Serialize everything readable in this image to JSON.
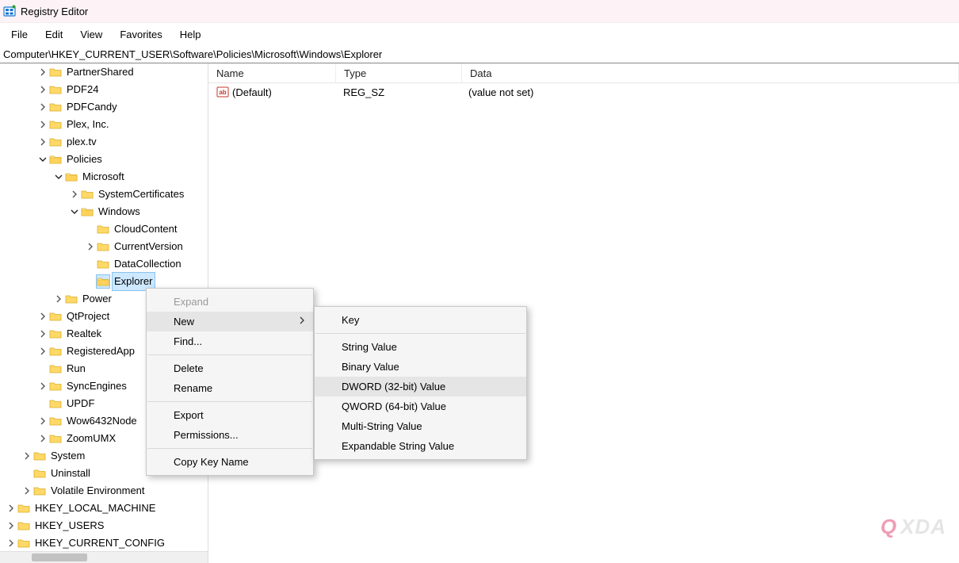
{
  "title": "Registry Editor",
  "menu": [
    "File",
    "Edit",
    "View",
    "Favorites",
    "Help"
  ],
  "address": "Computer\\HKEY_CURRENT_USER\\Software\\Policies\\Microsoft\\Windows\\Explorer",
  "tree": [
    {
      "depth": 2,
      "exp": "closed",
      "label": "PartnerShared"
    },
    {
      "depth": 2,
      "exp": "closed",
      "label": "PDF24"
    },
    {
      "depth": 2,
      "exp": "closed",
      "label": "PDFCandy"
    },
    {
      "depth": 2,
      "exp": "closed",
      "label": "Plex, Inc."
    },
    {
      "depth": 2,
      "exp": "closed",
      "label": "plex.tv"
    },
    {
      "depth": 2,
      "exp": "open",
      "label": "Policies"
    },
    {
      "depth": 3,
      "exp": "open",
      "label": "Microsoft"
    },
    {
      "depth": 4,
      "exp": "closed",
      "label": "SystemCertificates"
    },
    {
      "depth": 4,
      "exp": "open",
      "label": "Windows"
    },
    {
      "depth": 5,
      "exp": "none",
      "label": "CloudContent"
    },
    {
      "depth": 5,
      "exp": "closed",
      "label": "CurrentVersion"
    },
    {
      "depth": 5,
      "exp": "none",
      "label": "DataCollection"
    },
    {
      "depth": 5,
      "exp": "none",
      "label": "Explorer",
      "selected": true
    },
    {
      "depth": 3,
      "exp": "closed",
      "label": "Power"
    },
    {
      "depth": 2,
      "exp": "closed",
      "label": "QtProject"
    },
    {
      "depth": 2,
      "exp": "closed",
      "label": "Realtek"
    },
    {
      "depth": 2,
      "exp": "closed",
      "label": "RegisteredApp"
    },
    {
      "depth": 2,
      "exp": "none",
      "label": "Run"
    },
    {
      "depth": 2,
      "exp": "closed",
      "label": "SyncEngines"
    },
    {
      "depth": 2,
      "exp": "none",
      "label": "UPDF"
    },
    {
      "depth": 2,
      "exp": "closed",
      "label": "Wow6432Node"
    },
    {
      "depth": 2,
      "exp": "closed",
      "label": "ZoomUMX"
    },
    {
      "depth": 1,
      "exp": "closed",
      "label": "System"
    },
    {
      "depth": 1,
      "exp": "none",
      "label": "Uninstall"
    },
    {
      "depth": 1,
      "exp": "closed",
      "label": "Volatile Environment"
    },
    {
      "depth": 0,
      "exp": "closed",
      "label": "HKEY_LOCAL_MACHINE"
    },
    {
      "depth": 0,
      "exp": "closed",
      "label": "HKEY_USERS"
    },
    {
      "depth": 0,
      "exp": "closed",
      "label": "HKEY_CURRENT_CONFIG"
    }
  ],
  "list": {
    "headers": [
      "Name",
      "Type",
      "Data"
    ],
    "rows": [
      {
        "name": "(Default)",
        "type": "REG_SZ",
        "data": "(value not set)"
      }
    ]
  },
  "context_menu": {
    "items": [
      {
        "label": "Expand",
        "disabled": true
      },
      {
        "label": "New",
        "submenu": true,
        "hover": true
      },
      {
        "label": "Find..."
      },
      {
        "sep": true
      },
      {
        "label": "Delete"
      },
      {
        "label": "Rename"
      },
      {
        "sep": true
      },
      {
        "label": "Export"
      },
      {
        "label": "Permissions..."
      },
      {
        "sep": true
      },
      {
        "label": "Copy Key Name"
      }
    ]
  },
  "submenu_new": {
    "items": [
      {
        "label": "Key"
      },
      {
        "sep": true
      },
      {
        "label": "String Value"
      },
      {
        "label": "Binary Value"
      },
      {
        "label": "DWORD (32-bit) Value",
        "hover": true
      },
      {
        "label": "QWORD (64-bit) Value"
      },
      {
        "label": "Multi-String Value"
      },
      {
        "label": "Expandable String Value"
      }
    ]
  },
  "watermark": {
    "q": "Q",
    "rest": "XDA"
  }
}
